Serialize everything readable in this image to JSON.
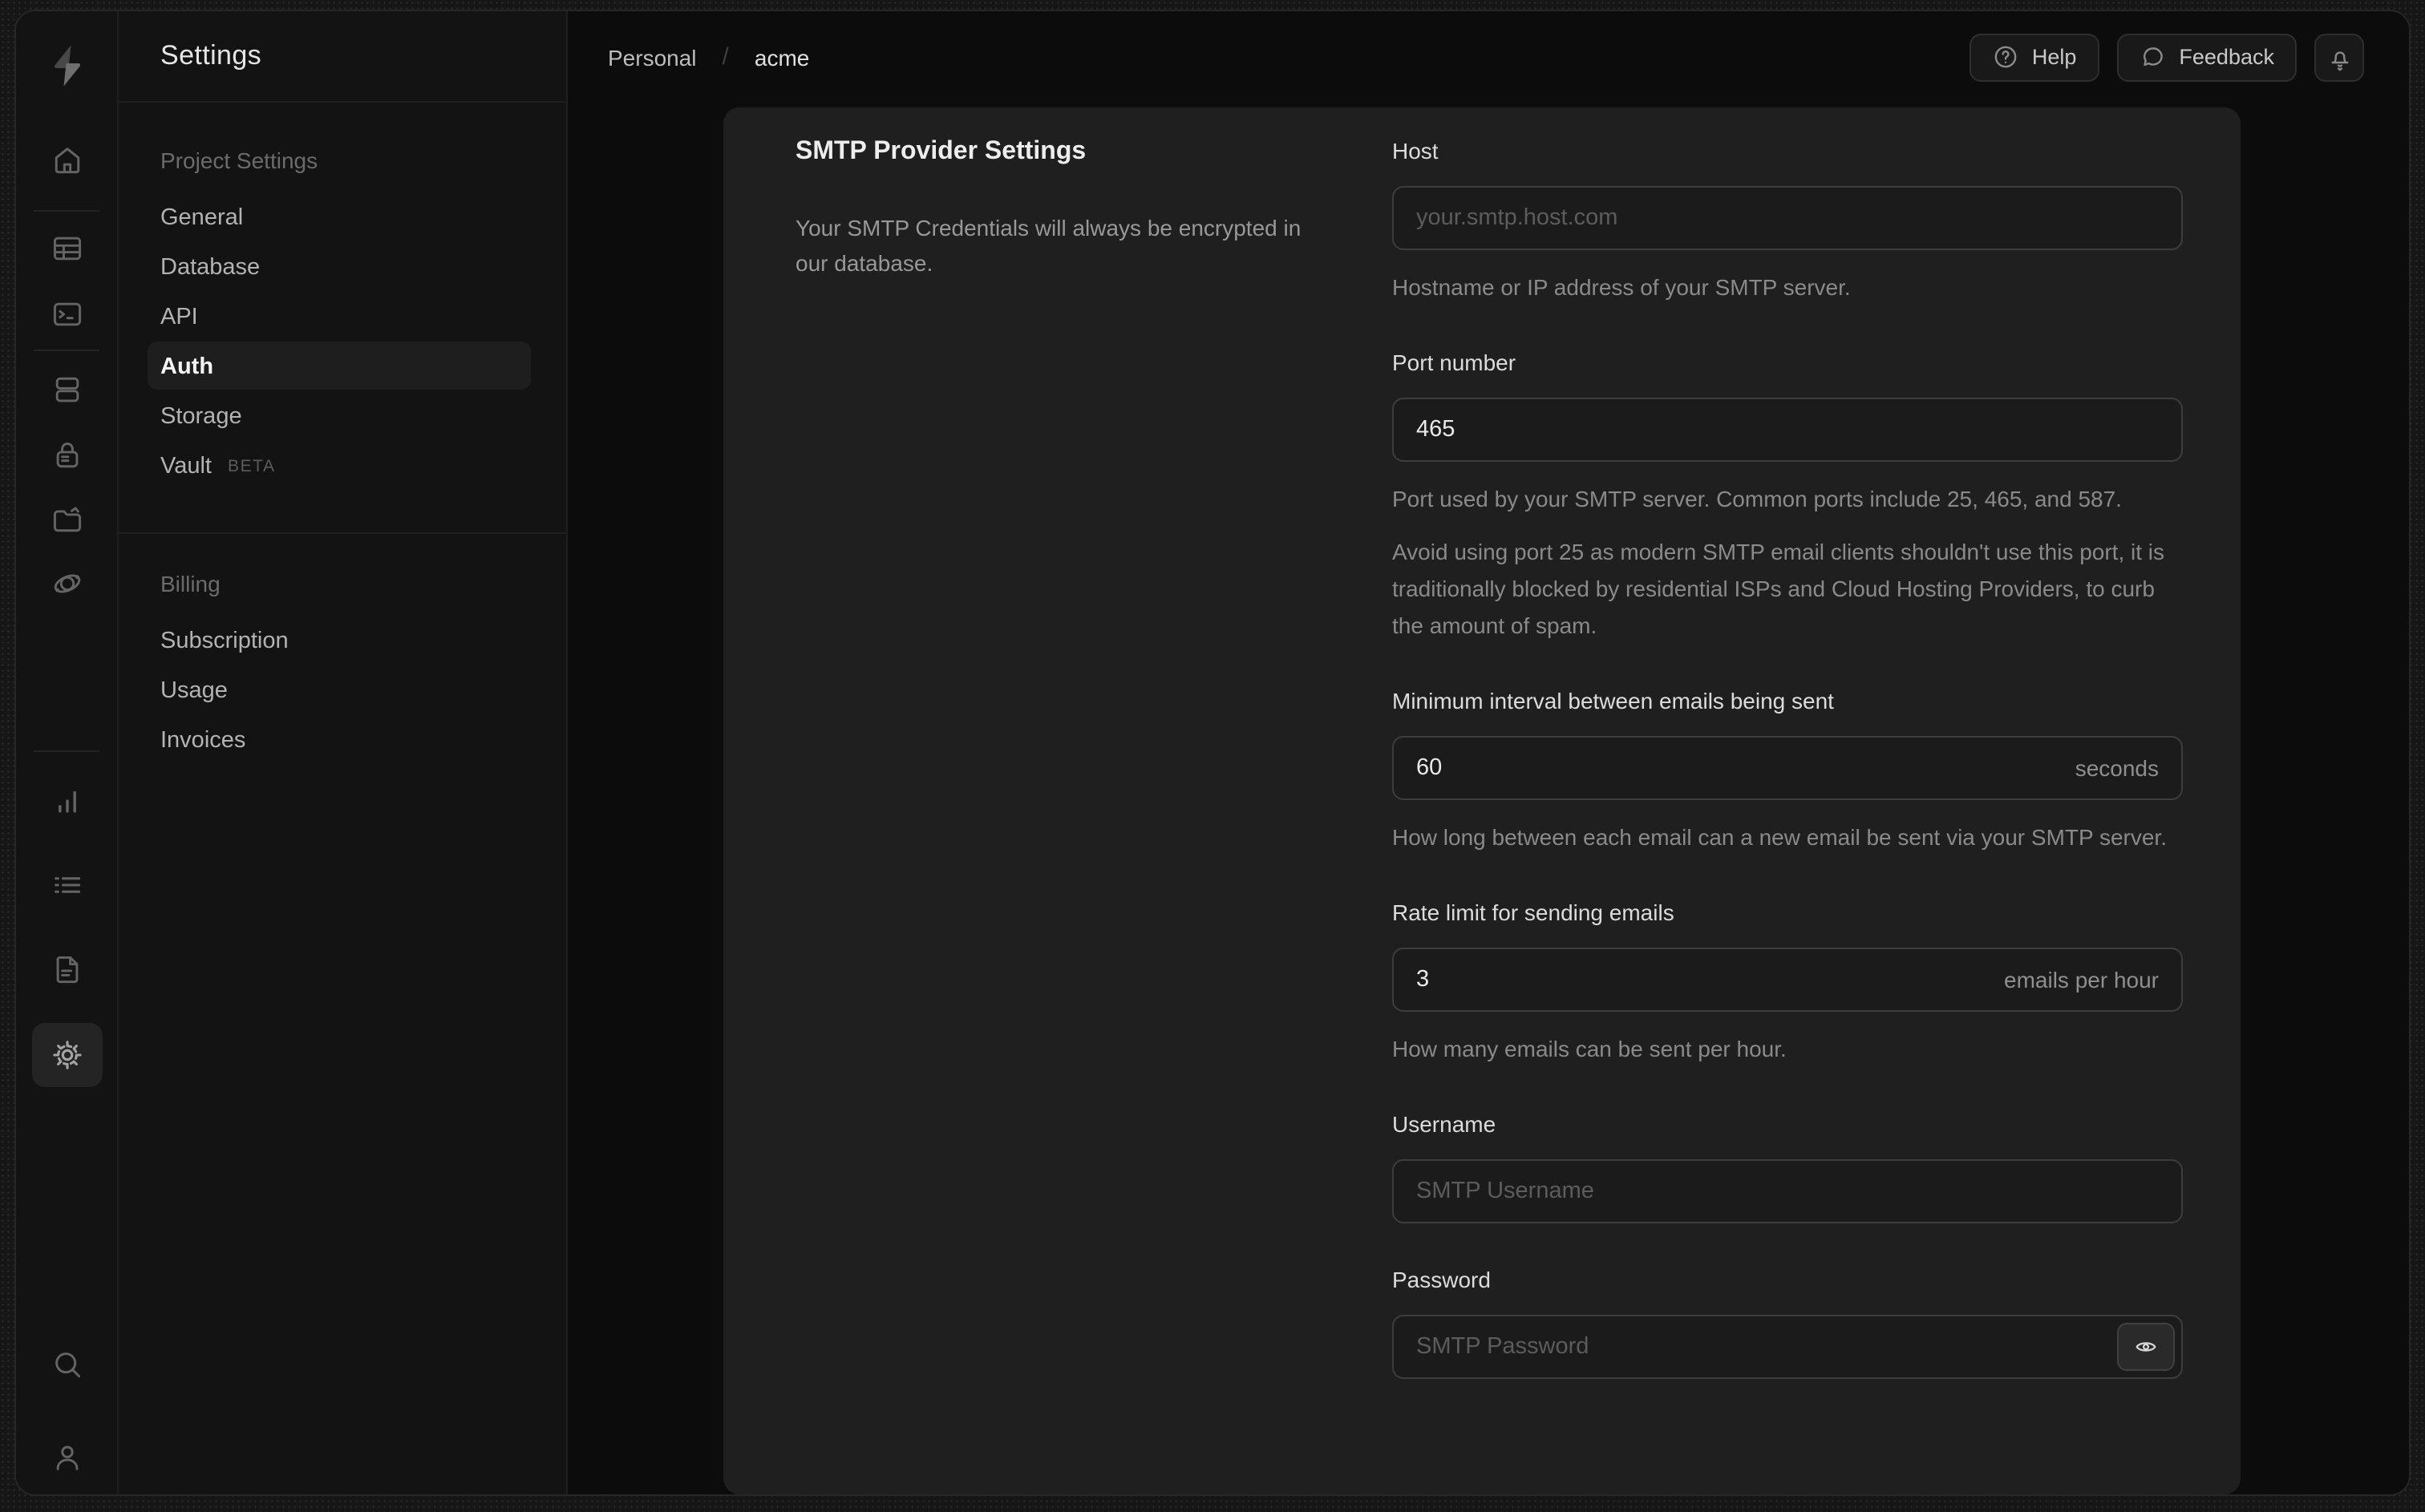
{
  "colors": {
    "desktop_bg": "#161616",
    "page_bg": "#0c0c0c",
    "sidebar_bg": "#131313",
    "card_bg": "#1f1f1f",
    "input_border": "#3d3d3d"
  },
  "nav_rail": {
    "items": [
      {
        "name": "home"
      },
      {
        "name": "table-editor"
      },
      {
        "name": "sql-editor"
      },
      {
        "name": "database"
      },
      {
        "name": "auth"
      },
      {
        "name": "storage"
      },
      {
        "name": "realtime"
      },
      {
        "name": "reports"
      },
      {
        "name": "logs"
      },
      {
        "name": "api-docs"
      },
      {
        "name": "settings",
        "active": true
      },
      {
        "name": "search"
      },
      {
        "name": "account"
      }
    ]
  },
  "sidebar": {
    "title": "Settings",
    "sections": [
      {
        "label": "Project Settings",
        "items": [
          {
            "label": "General"
          },
          {
            "label": "Database"
          },
          {
            "label": "API"
          },
          {
            "label": "Auth",
            "active": true
          },
          {
            "label": "Storage"
          },
          {
            "label": "Vault",
            "badge": "BETA"
          }
        ]
      },
      {
        "label": "Billing",
        "items": [
          {
            "label": "Subscription"
          },
          {
            "label": "Usage"
          },
          {
            "label": "Invoices"
          }
        ]
      }
    ]
  },
  "topbar": {
    "breadcrumb": {
      "org": "Personal",
      "separator": "/",
      "project": "acme"
    },
    "help_label": "Help",
    "feedback_label": "Feedback"
  },
  "panel": {
    "title": "SMTP Provider Settings",
    "description": "Your SMTP Credentials will always be encrypted in our database.",
    "fields": {
      "host": {
        "label": "Host",
        "placeholder": "your.smtp.host.com",
        "helper": "Hostname or IP address of your SMTP server."
      },
      "port": {
        "label": "Port number",
        "value": "465",
        "helper": "Port used by your SMTP server. Common ports include 25, 465, and 587.",
        "warning": "Avoid using port 25 as modern SMTP email clients shouldn't use this port, it is traditionally blocked by residential ISPs and Cloud Hosting Providers, to curb the amount of spam."
      },
      "interval": {
        "label": "Minimum interval between emails being sent",
        "value": "60",
        "suffix": "seconds",
        "helper": "How long between each email can a new email be sent via your SMTP server."
      },
      "rate": {
        "label": "Rate limit for sending emails",
        "value": "3",
        "suffix": "emails per hour",
        "helper": "How many emails can be sent per hour."
      },
      "username": {
        "label": "Username",
        "placeholder": "SMTP Username"
      },
      "password": {
        "label": "Password",
        "placeholder": "SMTP Password"
      }
    }
  }
}
